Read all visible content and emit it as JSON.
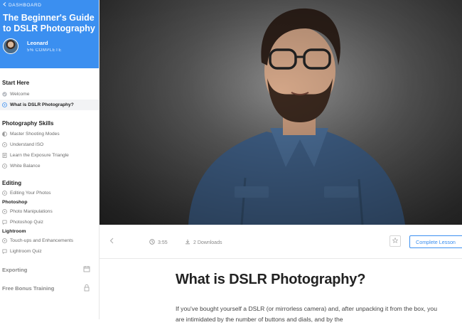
{
  "sidebar": {
    "back_label": "DASHBOARD",
    "course_title": "The Beginner's Guide to DSLR Photography",
    "student": {
      "name": "Leonard",
      "progress": "5% COMPLETE"
    },
    "sections": [
      {
        "title": "Start Here",
        "items": [
          {
            "label": "Welcome",
            "icon": "check-circle-icon",
            "active": false
          },
          {
            "label": "What is DSLR Photography?",
            "icon": "play-circle-icon",
            "active": true
          }
        ]
      },
      {
        "title": "Photography Skills",
        "items": [
          {
            "label": "Master Shooting Modes",
            "icon": "half-circle-icon"
          },
          {
            "label": "Understand ISO",
            "icon": "play-circle-icon"
          },
          {
            "label": "Learn the Exposure Triangle",
            "icon": "document-icon"
          },
          {
            "label": "White Balance",
            "icon": "play-circle-icon"
          }
        ]
      },
      {
        "title": "Editing",
        "items": [
          {
            "label": "Editing Your Photos",
            "icon": "play-circle-icon"
          }
        ],
        "subsections": [
          {
            "title": "Photoshop",
            "items": [
              {
                "label": "Photo Manipulations",
                "icon": "play-circle-icon"
              },
              {
                "label": "Photoshop Quiz",
                "icon": "chat-bubble-icon"
              }
            ]
          },
          {
            "title": "Lightroom",
            "items": [
              {
                "label": "Touch-ups and Enhancements",
                "icon": "play-circle-icon"
              },
              {
                "label": "Lightroom Quiz",
                "icon": "chat-bubble-icon"
              }
            ]
          }
        ]
      },
      {
        "title": "Exporting",
        "icon": "calendar-icon"
      },
      {
        "title": "Free Bonus Training",
        "icon": "lock-icon"
      }
    ]
  },
  "lesson_bar": {
    "duration": "3:55",
    "downloads": "2 Downloads",
    "complete_label": "Complete Lesson"
  },
  "lesson": {
    "title": "What is DSLR Photography?",
    "body": "If you've bought yourself a DSLR (or mirrorless camera) and, after unpacking it from the box, you are intimidated by the number of buttons and dials, and by the"
  },
  "colors": {
    "accent": "#3b8ff0",
    "sidebar_active_bg": "#f2f3f5"
  }
}
